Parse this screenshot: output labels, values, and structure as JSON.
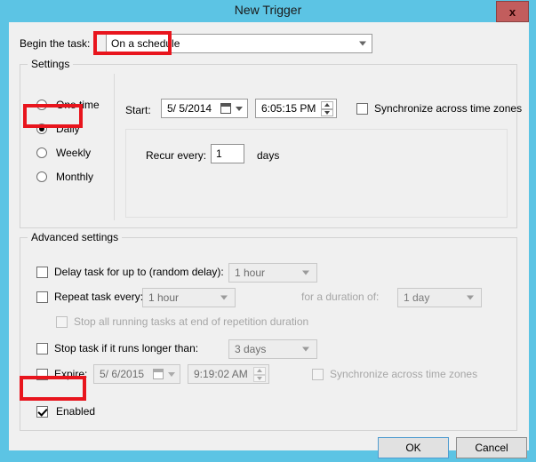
{
  "window": {
    "title": "New Trigger",
    "close_label": "x"
  },
  "begin": {
    "label": "Begin the task:",
    "value": "On a schedule"
  },
  "settings": {
    "legend": "Settings",
    "radios": [
      {
        "label": "One time",
        "checked": false
      },
      {
        "label": "Daily",
        "checked": true
      },
      {
        "label": "Weekly",
        "checked": false
      },
      {
        "label": "Monthly",
        "checked": false
      }
    ],
    "start_label": "Start:",
    "start_date": "5/  5/2014",
    "start_time": "6:05:15 PM",
    "sync_label": "Synchronize across time zones",
    "recur_label": "Recur every:",
    "recur_value": "1",
    "recur_unit": "days"
  },
  "advanced": {
    "legend": "Advanced settings",
    "delay_label": "Delay task for up to (random delay):",
    "delay_value": "1 hour",
    "repeat_label": "Repeat task every:",
    "repeat_value": "1 hour",
    "duration_label": "for a duration of:",
    "duration_value": "1 day",
    "stop_all_label": "Stop all running tasks at end of repetition duration",
    "stop_longer_label": "Stop task if it runs longer than:",
    "stop_longer_value": "3 days",
    "expire_label": "Expire:",
    "expire_date": "5/  6/2015",
    "expire_time": "9:19:02 AM",
    "expire_sync_label": "Synchronize across time zones",
    "enabled_label": "Enabled"
  },
  "footer": {
    "ok_label": "OK",
    "cancel_label": "Cancel"
  },
  "colors": {
    "titlebar": "#5CC4E4",
    "dialog": "#F0F0F0",
    "annotation": "#E8151D",
    "close_button": "#C25D5D"
  }
}
